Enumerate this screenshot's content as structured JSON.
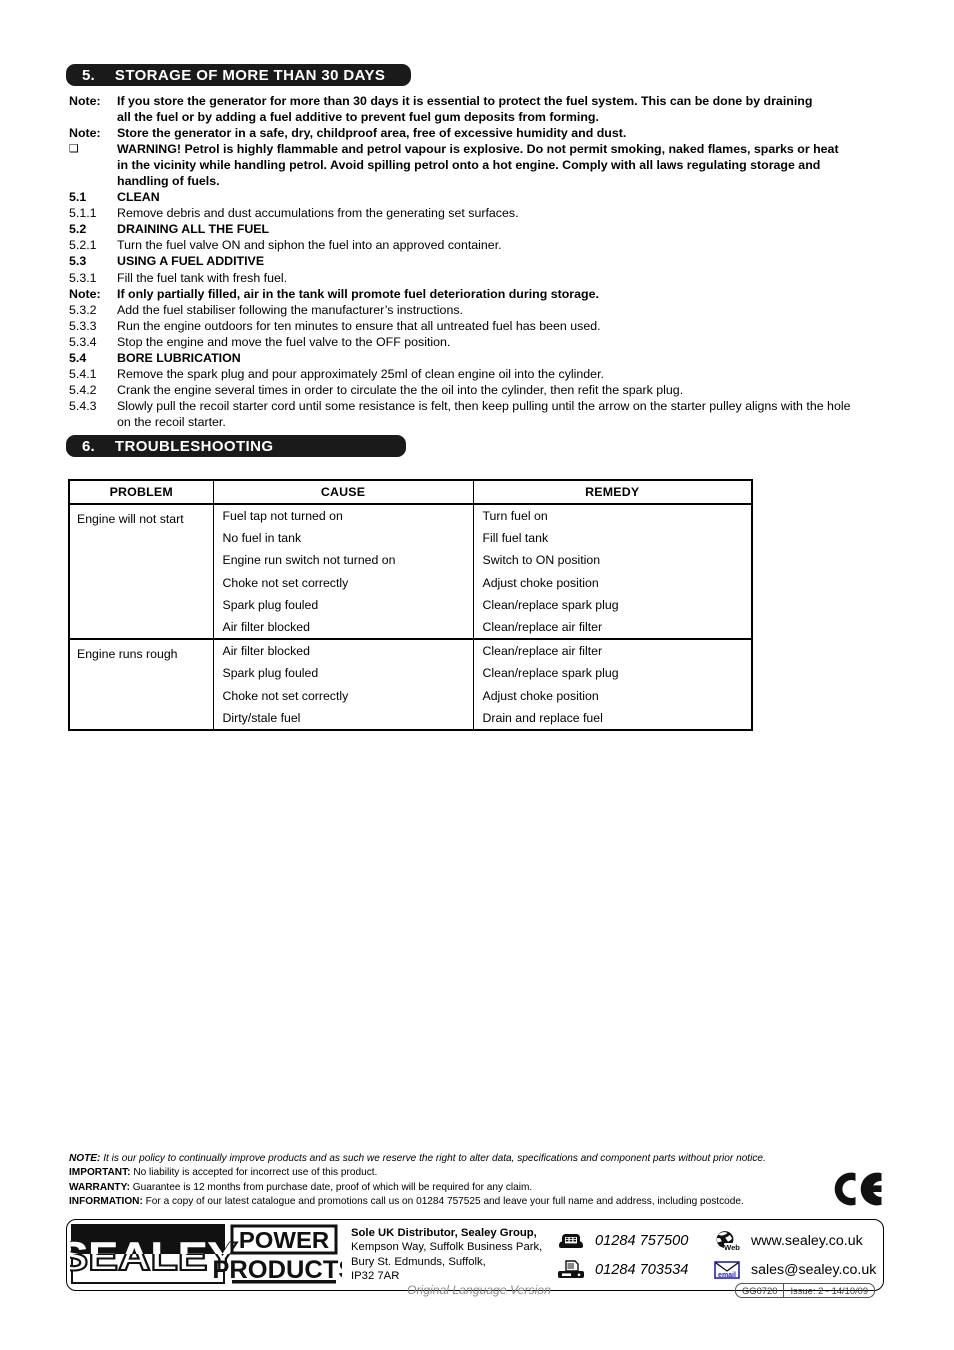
{
  "sections": {
    "storage": {
      "number": "5.",
      "title": "STORAGE OF MORE THAN 30 DAYS",
      "rows": [
        {
          "label": "Note:",
          "text": "If you store the generator for more than 30 days it is essential to protect the fuel system. This can be done by draining",
          "style": "bold"
        },
        {
          "label": "",
          "text": "all the fuel or by adding a fuel additive to prevent fuel gum deposits from forming.",
          "style": "bold-cont"
        },
        {
          "label": "Note:",
          "text": "Store the generator in a safe, dry, childproof area, free of excessive humidity and dust.",
          "style": "bold"
        },
        {
          "label": "❑",
          "text": "WARNING! Petrol is highly flammable and petrol vapour is explosive. Do not permit smoking, naked flames, sparks or heat",
          "style": "bold-glyph"
        },
        {
          "label": "",
          "text": "in the vicinity while handling petrol. Avoid spilling petrol onto a hot engine. Comply with all laws regulating storage and",
          "style": "bold-cont"
        },
        {
          "label": "",
          "text": "handling of fuels.",
          "style": "bold-cont"
        },
        {
          "label": "5.1",
          "text": "CLEAN",
          "style": "bold"
        },
        {
          "label": "5.1.1",
          "text": "Remove debris and dust accumulations from the generating set surfaces.",
          "style": "normal"
        },
        {
          "label": "5.2",
          "text": "DRAINING ALL THE FUEL",
          "style": "bold"
        },
        {
          "label": "5.2.1",
          "text": "Turn the fuel valve ON and siphon the fuel into an approved container.",
          "style": "normal"
        },
        {
          "label": "5.3",
          "text": "USING A FUEL ADDITIVE",
          "style": "bold"
        },
        {
          "label": "5.3.1",
          "text": "Fill the fuel tank with fresh fuel.",
          "style": "normal"
        },
        {
          "label": "Note:",
          "text": "If only partially filled, air in the tank will promote fuel deterioration during storage.",
          "style": "bold"
        },
        {
          "label": "5.3.2",
          "text": "Add the fuel stabiliser following the manufacturer’s instructions.",
          "style": "normal"
        },
        {
          "label": "5.3.3",
          "text": "Run the engine outdoors for ten minutes to ensure that all untreated fuel has been used.",
          "style": "normal"
        },
        {
          "label": "5.3.4",
          "text": "Stop the engine and move the fuel valve to the OFF position.",
          "style": "normal"
        },
        {
          "label": "5.4",
          "text": "BORE LUBRICATION",
          "style": "bold"
        },
        {
          "label": "5.4.1",
          "text": "Remove the spark plug and pour approximately 25ml of clean engine oil into the cylinder.",
          "style": "normal"
        },
        {
          "label": "5.4.2",
          "text": "Crank the engine several times in order to circulate the the oil into the cylinder, then refit the spark plug.",
          "style": "normal"
        },
        {
          "label": "5.4.3",
          "text": "Slowly pull the recoil starter cord until some resistance is felt, then keep pulling until the arrow on the starter pulley aligns with the hole",
          "style": "normal"
        },
        {
          "label": "",
          "text": "on the recoil starter.",
          "style": "normal-cont"
        }
      ]
    },
    "troubleshooting": {
      "number": "6.",
      "title": "TROUBLESHOOTING",
      "table": {
        "headers": [
          "PROBLEM",
          "CAUSE",
          "REMEDY"
        ],
        "groups": [
          {
            "problem": "Engine will not start",
            "causes": [
              "Fuel tap not turned on",
              "No fuel in tank",
              "Engine run switch not turned on",
              "Choke not set correctly",
              "Spark plug fouled",
              "Air filter blocked"
            ],
            "remedies": [
              "Turn fuel on",
              "Fill fuel tank",
              "Switch to ON position",
              "Adjust choke position",
              "Clean/replace spark plug",
              "Clean/replace air filter"
            ]
          },
          {
            "problem": "Engine runs rough",
            "causes": [
              "Air filter blocked",
              "Spark plug fouled",
              "Choke not set correctly",
              "Dirty/stale fuel"
            ],
            "remedies": [
              "Clean/replace air filter",
              "Clean/replace spark plug",
              "Adjust choke position",
              "Drain and replace fuel"
            ]
          }
        ]
      }
    }
  },
  "legal": {
    "note_key": "NOTE:",
    "note_text": "It is our policy to continually improve products and as such we reserve the right to alter data, specifications and component parts without prior notice.",
    "important_key": "IMPORTANT:",
    "important_text": "No liability is accepted for incorrect use of this product.",
    "warranty_key": "WARRANTY:",
    "warranty_text": "Guarantee is 12 months from purchase date, proof of which will be required for any claim.",
    "information_key": "INFORMATION:",
    "information_text": "For a copy of our latest catalogue and promotions call us on 01284 757525 and leave your full name and address, including postcode."
  },
  "footer": {
    "logo": {
      "brand": "SEALEY",
      "line1": "POWER",
      "line2": "PRODUCTS"
    },
    "address": {
      "line1_bold": "Sole UK Distributor, Sealey Group,",
      "line2": "Kempson Way, Suffolk Business Park,",
      "line3": "Bury St. Edmunds, Suffolk,",
      "line4": "IP32 7AR"
    },
    "contacts": {
      "phone": "01284 757500",
      "fax": "01284 703534",
      "web": "www.sealey.co.uk",
      "email": "sales@sealey.co.uk",
      "web_icon_label": "Web",
      "email_icon_label": "email"
    },
    "original_language": "Original Language Version",
    "model": "GG0720",
    "issue": "Issue: 2 - 14/10/09",
    "ce_mark": "CE"
  },
  "colors": {
    "bar_background": "#1a1a1a",
    "bar_text": "#ffffff",
    "body_text": "#000000",
    "muted_text": "#8a8a8a",
    "email_icon_blue": "#2020c0"
  }
}
